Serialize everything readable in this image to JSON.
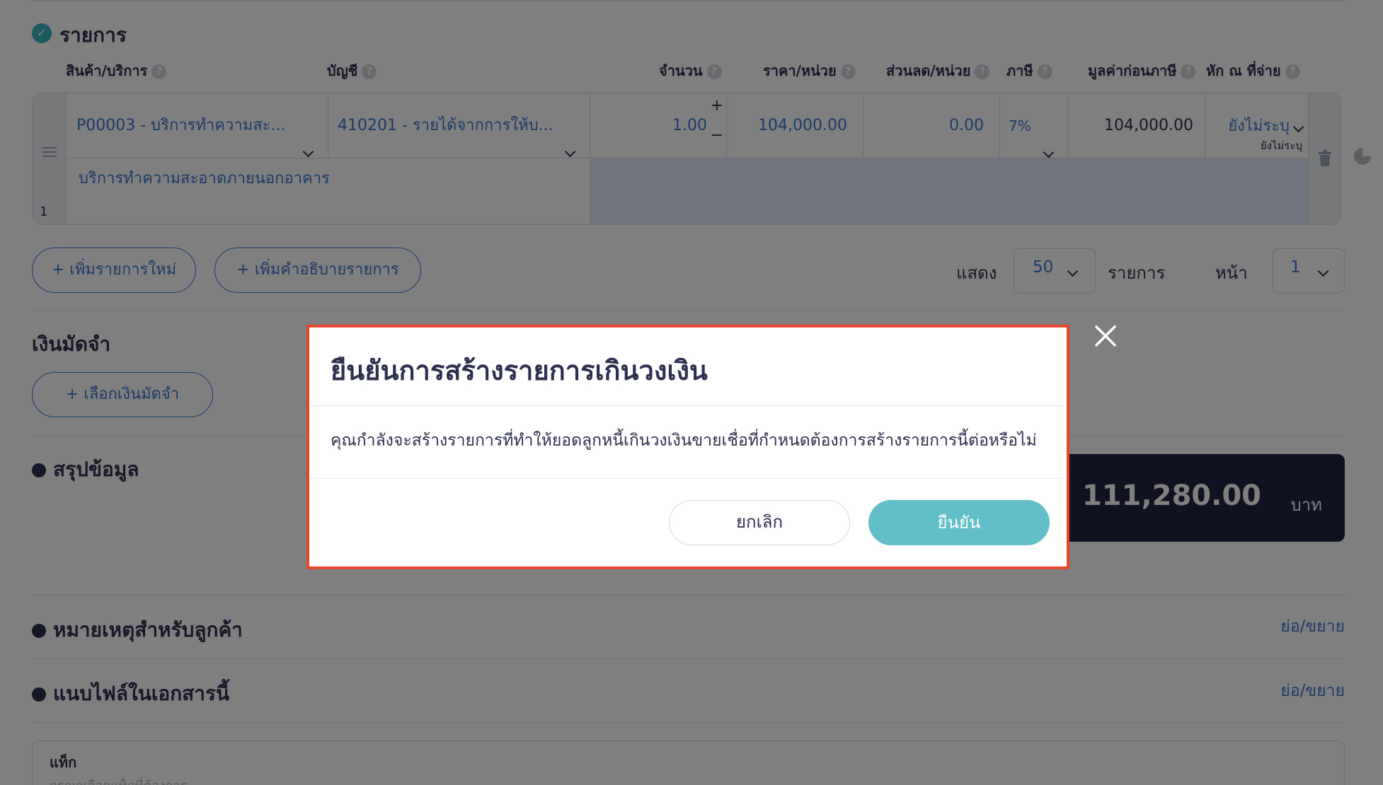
{
  "items_section": {
    "title": "รายการ",
    "columns": [
      {
        "label": "สินค้า/บริการ"
      },
      {
        "label": "บัญชี"
      },
      {
        "label": "จำนวน"
      },
      {
        "label": "ราคา/หน่วย"
      },
      {
        "label": "ส่วนลด/หน่วย"
      },
      {
        "label": "ภาษี"
      },
      {
        "label": "มูลค่าก่อนภาษี"
      },
      {
        "label": "หัก ณ ที่จ่าย"
      }
    ],
    "row": {
      "number": "1",
      "product": "P00003 - บริการทำความสะ...",
      "account": "410201 - รายได้จากการให้บ...",
      "quantity": "1.00",
      "unit_price": "104,000.00",
      "discount": "0.00",
      "vat": "7%",
      "pre_tax_value": "104,000.00",
      "withholding": "ยังไม่ระบุ",
      "withholding_sub": "ยังไม่ระบุ",
      "description": "บริการทำความสะอาดภายนอกอาคาร"
    },
    "add_item_label": "+ เพิ่มรายการใหม่",
    "add_desc_label": "+ เพิ่มคำอธิบายรายการ",
    "show_label": "แสดง",
    "per_page": "50",
    "items_label": "รายการ",
    "page_label": "หน้า",
    "page_value": "1"
  },
  "deposit": {
    "title": "เงินมัดจำ",
    "select_label": "+ เลือกเงินมัดจำ"
  },
  "summary": {
    "title": "สรุปข้อมูล",
    "total": "111,280.00",
    "currency": "บาท"
  },
  "notes": {
    "title": "หมายเหตุสำหรับลูกค้า",
    "toggle": "ย่อ/ขยาย"
  },
  "attachments": {
    "title": "แนบไฟล์ในเอกสารนี้",
    "toggle": "ย่อ/ขยาย"
  },
  "tags": {
    "label": "แท็ก",
    "placeholder": "กรุณาเลือกแท็กที่ต้องการ"
  },
  "modal": {
    "title": "ยืนยันการสร้างรายการเกินวงเงิน",
    "message": "คุณกำลังจะสร้างรายการที่ทำให้ยอดลูกหนี้เกินวงเงินขายเชื่อที่กำหนดต้องการสร้างรายการนี้ต่อหรือไม่",
    "cancel_label": "ยกเลิก",
    "confirm_label": "ยืนยัน"
  },
  "colors": {
    "accent": "#62bfc9",
    "link": "#3c74d3",
    "highlight_border": "#e8452c",
    "summary_bg": "#232542"
  },
  "icons": {
    "section": "check-circle-icon",
    "help": "question-circle-icon",
    "delete": "trash-icon",
    "pie": "pie-chart-icon",
    "close": "close-icon",
    "drag": "drag-handle-icon"
  }
}
